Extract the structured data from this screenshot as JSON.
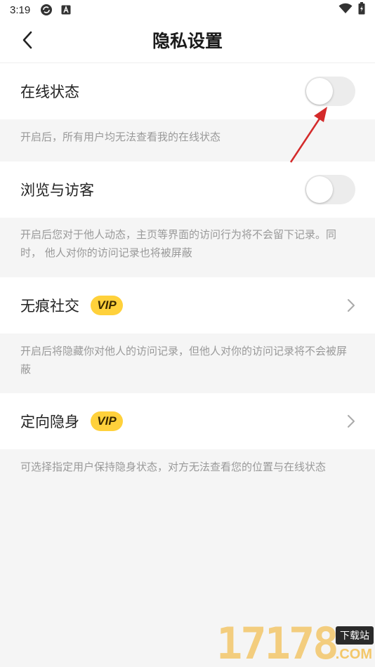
{
  "status_bar": {
    "time": "3:19",
    "icons": [
      "sync-icon",
      "a-badge-icon",
      "wifi-icon",
      "battery-icon"
    ]
  },
  "header": {
    "title": "隐私设置",
    "back_icon": "chevron-left-icon"
  },
  "settings": [
    {
      "label": "在线状态",
      "control": "toggle",
      "on": false,
      "description": "开启后，所有用户均无法查看我的在线状态"
    },
    {
      "label": "浏览与访客",
      "control": "toggle",
      "on": false,
      "description": "开启后您对于他人动态，主页等界面的访问行为将不会留下记录。同时， 他人对你的访问记录也将被屏蔽"
    },
    {
      "label": "无痕社交",
      "badge": "VIP",
      "control": "chevron",
      "description": "开启后将隐藏你对他人的访问记录，但他人对你的访问记录将不会被屏蔽"
    },
    {
      "label": "定向隐身",
      "badge": "VIP",
      "control": "chevron",
      "description": "可选择指定用户保持隐身状态，对方无法查看您的位置与在线状态"
    }
  ],
  "watermark": {
    "number": "17178",
    "tag": "下载站",
    "suffix": ".COM"
  },
  "colors": {
    "vip_badge": "#ffd13b",
    "toggle_off": "#ececec",
    "annotation_arrow": "#d42a2a",
    "description_text": "#999999"
  }
}
